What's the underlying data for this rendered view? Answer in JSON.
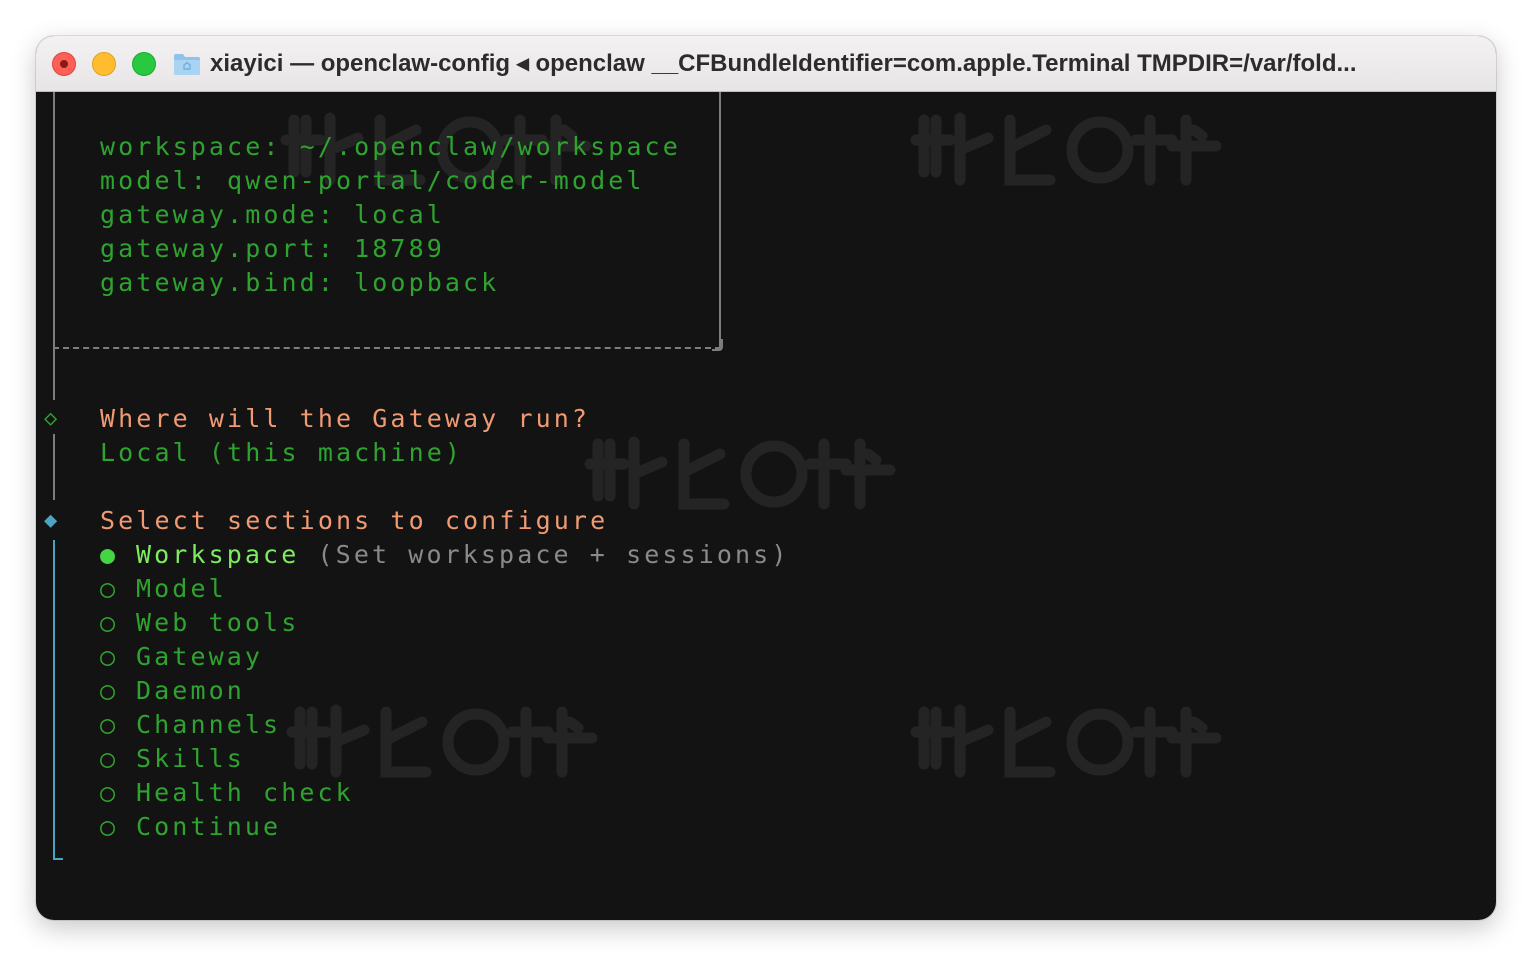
{
  "window": {
    "title": "xiayici — openclaw-config ◂ openclaw __CFBundleIdentifier=com.apple.Terminal TMPDIR=/var/fold..."
  },
  "config_box": {
    "lines": [
      "workspace: ~/.openclaw/workspace",
      "model: qwen-portal/coder-model",
      "gateway.mode: local",
      "gateway.port: 18789",
      "gateway.bind: loopback"
    ]
  },
  "gateway_question": {
    "symbol": "◇",
    "label": "Where will the Gateway run?",
    "answer": "Local (this machine)"
  },
  "sections_prompt": {
    "symbol": "◆",
    "label": "Select sections to configure",
    "options": [
      {
        "bullet": "●",
        "label": "Workspace",
        "hint": "(Set workspace + sessions)"
      },
      {
        "bullet": "○",
        "label": "Model"
      },
      {
        "bullet": "○",
        "label": "Web tools"
      },
      {
        "bullet": "○",
        "label": "Gateway"
      },
      {
        "bullet": "○",
        "label": "Daemon"
      },
      {
        "bullet": "○",
        "label": "Channels"
      },
      {
        "bullet": "○",
        "label": "Skills"
      },
      {
        "bullet": "○",
        "label": "Health check"
      },
      {
        "bullet": "○",
        "label": "Continue"
      }
    ]
  },
  "colors": {
    "terminal_bg": "#131313",
    "config_text": "#2fa32f",
    "prompt_label": "#f09a73",
    "active_option": "#7dec5f",
    "hint_text": "#8a8a8a",
    "active_bar": "#4aa5c4",
    "inactive_bar": "#7d7d7d"
  },
  "icons": {
    "titlebar_folder": "folder-icon",
    "window_close": "close-button",
    "window_minimize": "minimize-button",
    "window_zoom": "zoom-button"
  }
}
